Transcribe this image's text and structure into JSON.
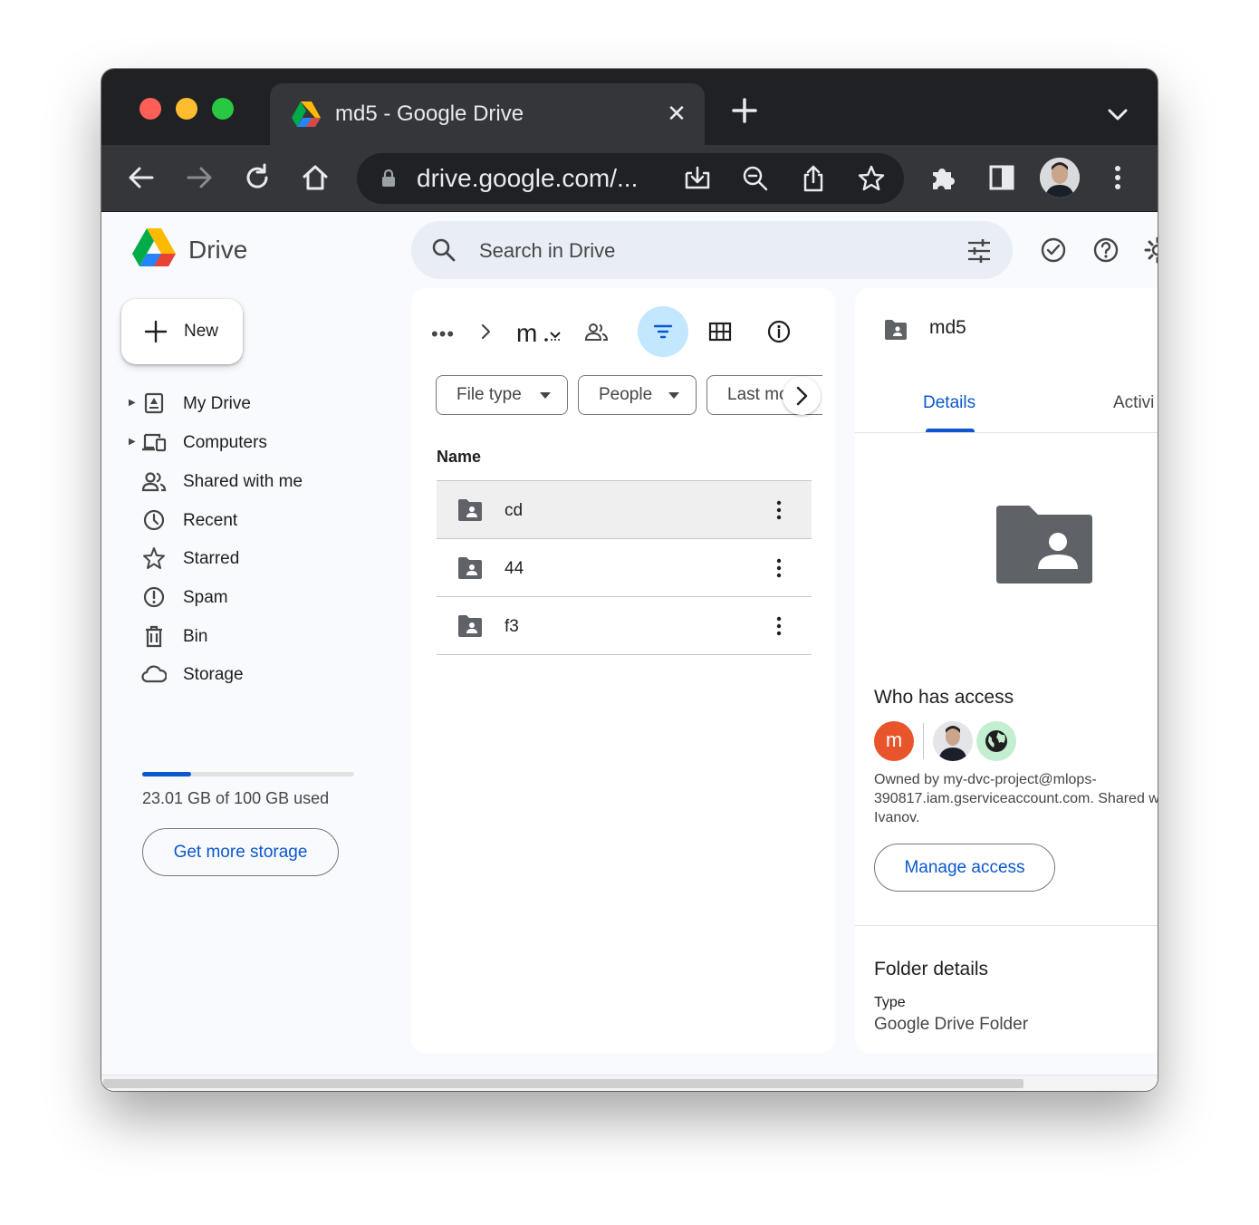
{
  "browser": {
    "tab_title": "md5 - Google Drive",
    "url": "drive.google.com/..."
  },
  "app": {
    "name": "Drive",
    "search_placeholder": "Search in Drive"
  },
  "sidebar": {
    "new_label": "New",
    "items": [
      {
        "label": "My Drive",
        "icon": "my-drive-icon",
        "expandable": true
      },
      {
        "label": "Computers",
        "icon": "computers-icon",
        "expandable": true
      },
      {
        "label": "Shared with me",
        "icon": "shared-with-me-icon",
        "expandable": false
      },
      {
        "label": "Recent",
        "icon": "clock-icon",
        "expandable": false
      },
      {
        "label": "Starred",
        "icon": "star-icon",
        "expandable": false
      },
      {
        "label": "Spam",
        "icon": "spam-icon",
        "expandable": false
      },
      {
        "label": "Bin",
        "icon": "bin-icon",
        "expandable": false
      },
      {
        "label": "Storage",
        "icon": "cloud-icon",
        "expandable": false
      }
    ],
    "storage": {
      "used_fraction": 0.2301,
      "text": "23.01 GB of 100 GB used",
      "button_label": "Get more storage"
    }
  },
  "main": {
    "breadcrumb_current": "m",
    "filters": [
      {
        "label": "File type"
      },
      {
        "label": "People"
      },
      {
        "label": "Last mo"
      }
    ],
    "column_name": "Name",
    "files": [
      {
        "name": "cd",
        "selected": true
      },
      {
        "name": "44",
        "selected": false
      },
      {
        "name": "f3",
        "selected": false
      }
    ]
  },
  "details": {
    "title": "md5",
    "tabs": [
      {
        "label": "Details",
        "active": true
      },
      {
        "label": "Activi",
        "active": false
      }
    ],
    "who_has_access": "Who has access",
    "owner_initial": "m",
    "owned_text": "Owned by my-dvc-project@mlops-390817.iam.gserviceaccount.com. Shared w Ivanov.",
    "manage_access": "Manage access",
    "folder_details_title": "Folder details",
    "type_label": "Type",
    "type_value": "Google Drive Folder"
  },
  "colors": {
    "accent": "#0b57d0",
    "filter_active_bg": "#c2e7ff",
    "owner_avatar": "#e8552a",
    "chrome_dark": "#202124"
  }
}
